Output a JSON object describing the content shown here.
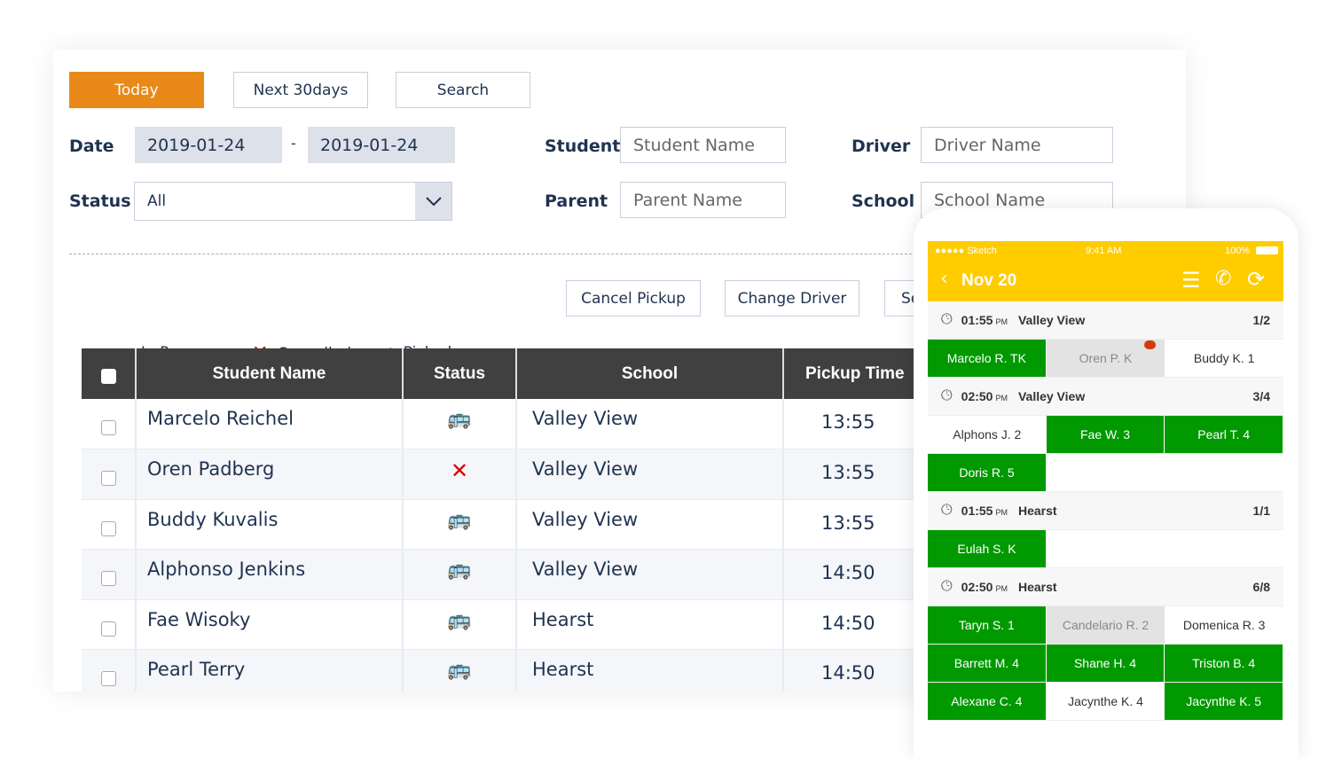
{
  "buttons": {
    "today": "Today",
    "next30": "Next 30days",
    "search": "Search",
    "cancel_pickup": "Cancel Pickup",
    "change_driver": "Change Driver",
    "third": "Se"
  },
  "filters": {
    "date_label": "Date",
    "date_from": "2019-01-24",
    "date_sep": "-",
    "date_to": "2019-01-24",
    "status_label": "Status",
    "status_value": "All",
    "student_label": "Student",
    "student_ph": "Student Name",
    "parent_label": "Parent",
    "parent_ph": "Parent Name",
    "driver_label": "Driver",
    "driver_ph": "Driver Name",
    "school_label": "School",
    "school_ph": "School Name"
  },
  "legend": {
    "in_process": "In Process",
    "cancelled": "Cancelled",
    "picked": "Picked"
  },
  "colors": {
    "accent": "#e8891a",
    "yellow": "#ffcc00",
    "green": "#009900",
    "cancel": "#d40000"
  },
  "table": {
    "headers": [
      "Student Name",
      "Status",
      "School",
      "Pickup Time"
    ],
    "rows": [
      {
        "name": "Marcelo Reichel",
        "status": "bus-icon",
        "school": "Valley View",
        "time": "13:55"
      },
      {
        "name": "Oren Padberg",
        "status": "cancel-icon",
        "school": "Valley View",
        "time": "13:55"
      },
      {
        "name": "Buddy Kuvalis",
        "status": "bus-icon",
        "school": "Valley View",
        "time": "13:55"
      },
      {
        "name": "Alphonso Jenkins",
        "status": "bus-icon",
        "school": "Valley View",
        "time": "14:50"
      },
      {
        "name": "Fae Wisoky",
        "status": "bus-icon",
        "school": "Hearst",
        "time": "14:50"
      },
      {
        "name": "Pearl Terry",
        "status": "bus-icon",
        "school": "Hearst",
        "time": "14:50"
      }
    ]
  },
  "phone": {
    "carrier": "●●●●● Sketch",
    "clock": "9:41 AM",
    "battery": "100%",
    "title": "Nov 20",
    "groups": [
      {
        "time": "01:55",
        "ampm": "PM",
        "school": "Valley View",
        "count": "1/2",
        "cells": [
          {
            "t": "Marcelo R. TK",
            "s": "g"
          },
          {
            "t": "Oren P. K",
            "s": "x",
            "msg": true
          },
          {
            "t": "Buddy K. 1",
            "s": "w"
          }
        ]
      },
      {
        "time": "02:50",
        "ampm": "PM",
        "school": "Valley View",
        "count": "3/4",
        "cells": [
          {
            "t": "Alphons J. 2",
            "s": "w"
          },
          {
            "t": "Fae W. 3",
            "s": "g"
          },
          {
            "t": "Pearl T. 4",
            "s": "g"
          },
          {
            "t": "Doris R. 5",
            "s": "g"
          }
        ]
      },
      {
        "time": "01:55",
        "ampm": "PM",
        "school": "Hearst",
        "count": "1/1",
        "cells": [
          {
            "t": "Eulah S. K",
            "s": "g"
          }
        ]
      },
      {
        "time": "02:50",
        "ampm": "PM",
        "school": "Hearst",
        "count": "6/8",
        "cells": [
          {
            "t": "Taryn S. 1",
            "s": "g"
          },
          {
            "t": "Candelario R. 2",
            "s": "x"
          },
          {
            "t": "Domenica R. 3",
            "s": "w"
          },
          {
            "t": "Barrett M. 4",
            "s": "g"
          },
          {
            "t": "Shane H. 4",
            "s": "g"
          },
          {
            "t": "Triston B. 4",
            "s": "g"
          },
          {
            "t": "Alexane C. 4",
            "s": "g"
          },
          {
            "t": "Jacynthe K. 4",
            "s": "w"
          },
          {
            "t": "Jacynthe K. 5",
            "s": "g"
          }
        ]
      }
    ]
  }
}
